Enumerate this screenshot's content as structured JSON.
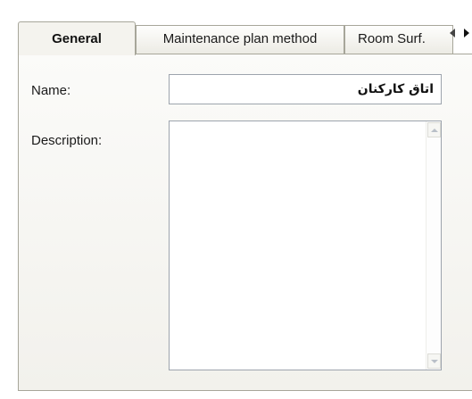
{
  "tabs": {
    "general": "General",
    "maintenance": "Maintenance plan method",
    "room": "Room Surf."
  },
  "form": {
    "name_label": "Name:",
    "name_value": "اتاق کارکنان",
    "description_label": "Description:"
  },
  "icons": {
    "tab_scroll_left": "arrow-left-icon",
    "tab_scroll_right": "arrow-right-icon",
    "scroll_up": "chevron-up-icon",
    "scroll_down": "chevron-down-icon"
  }
}
